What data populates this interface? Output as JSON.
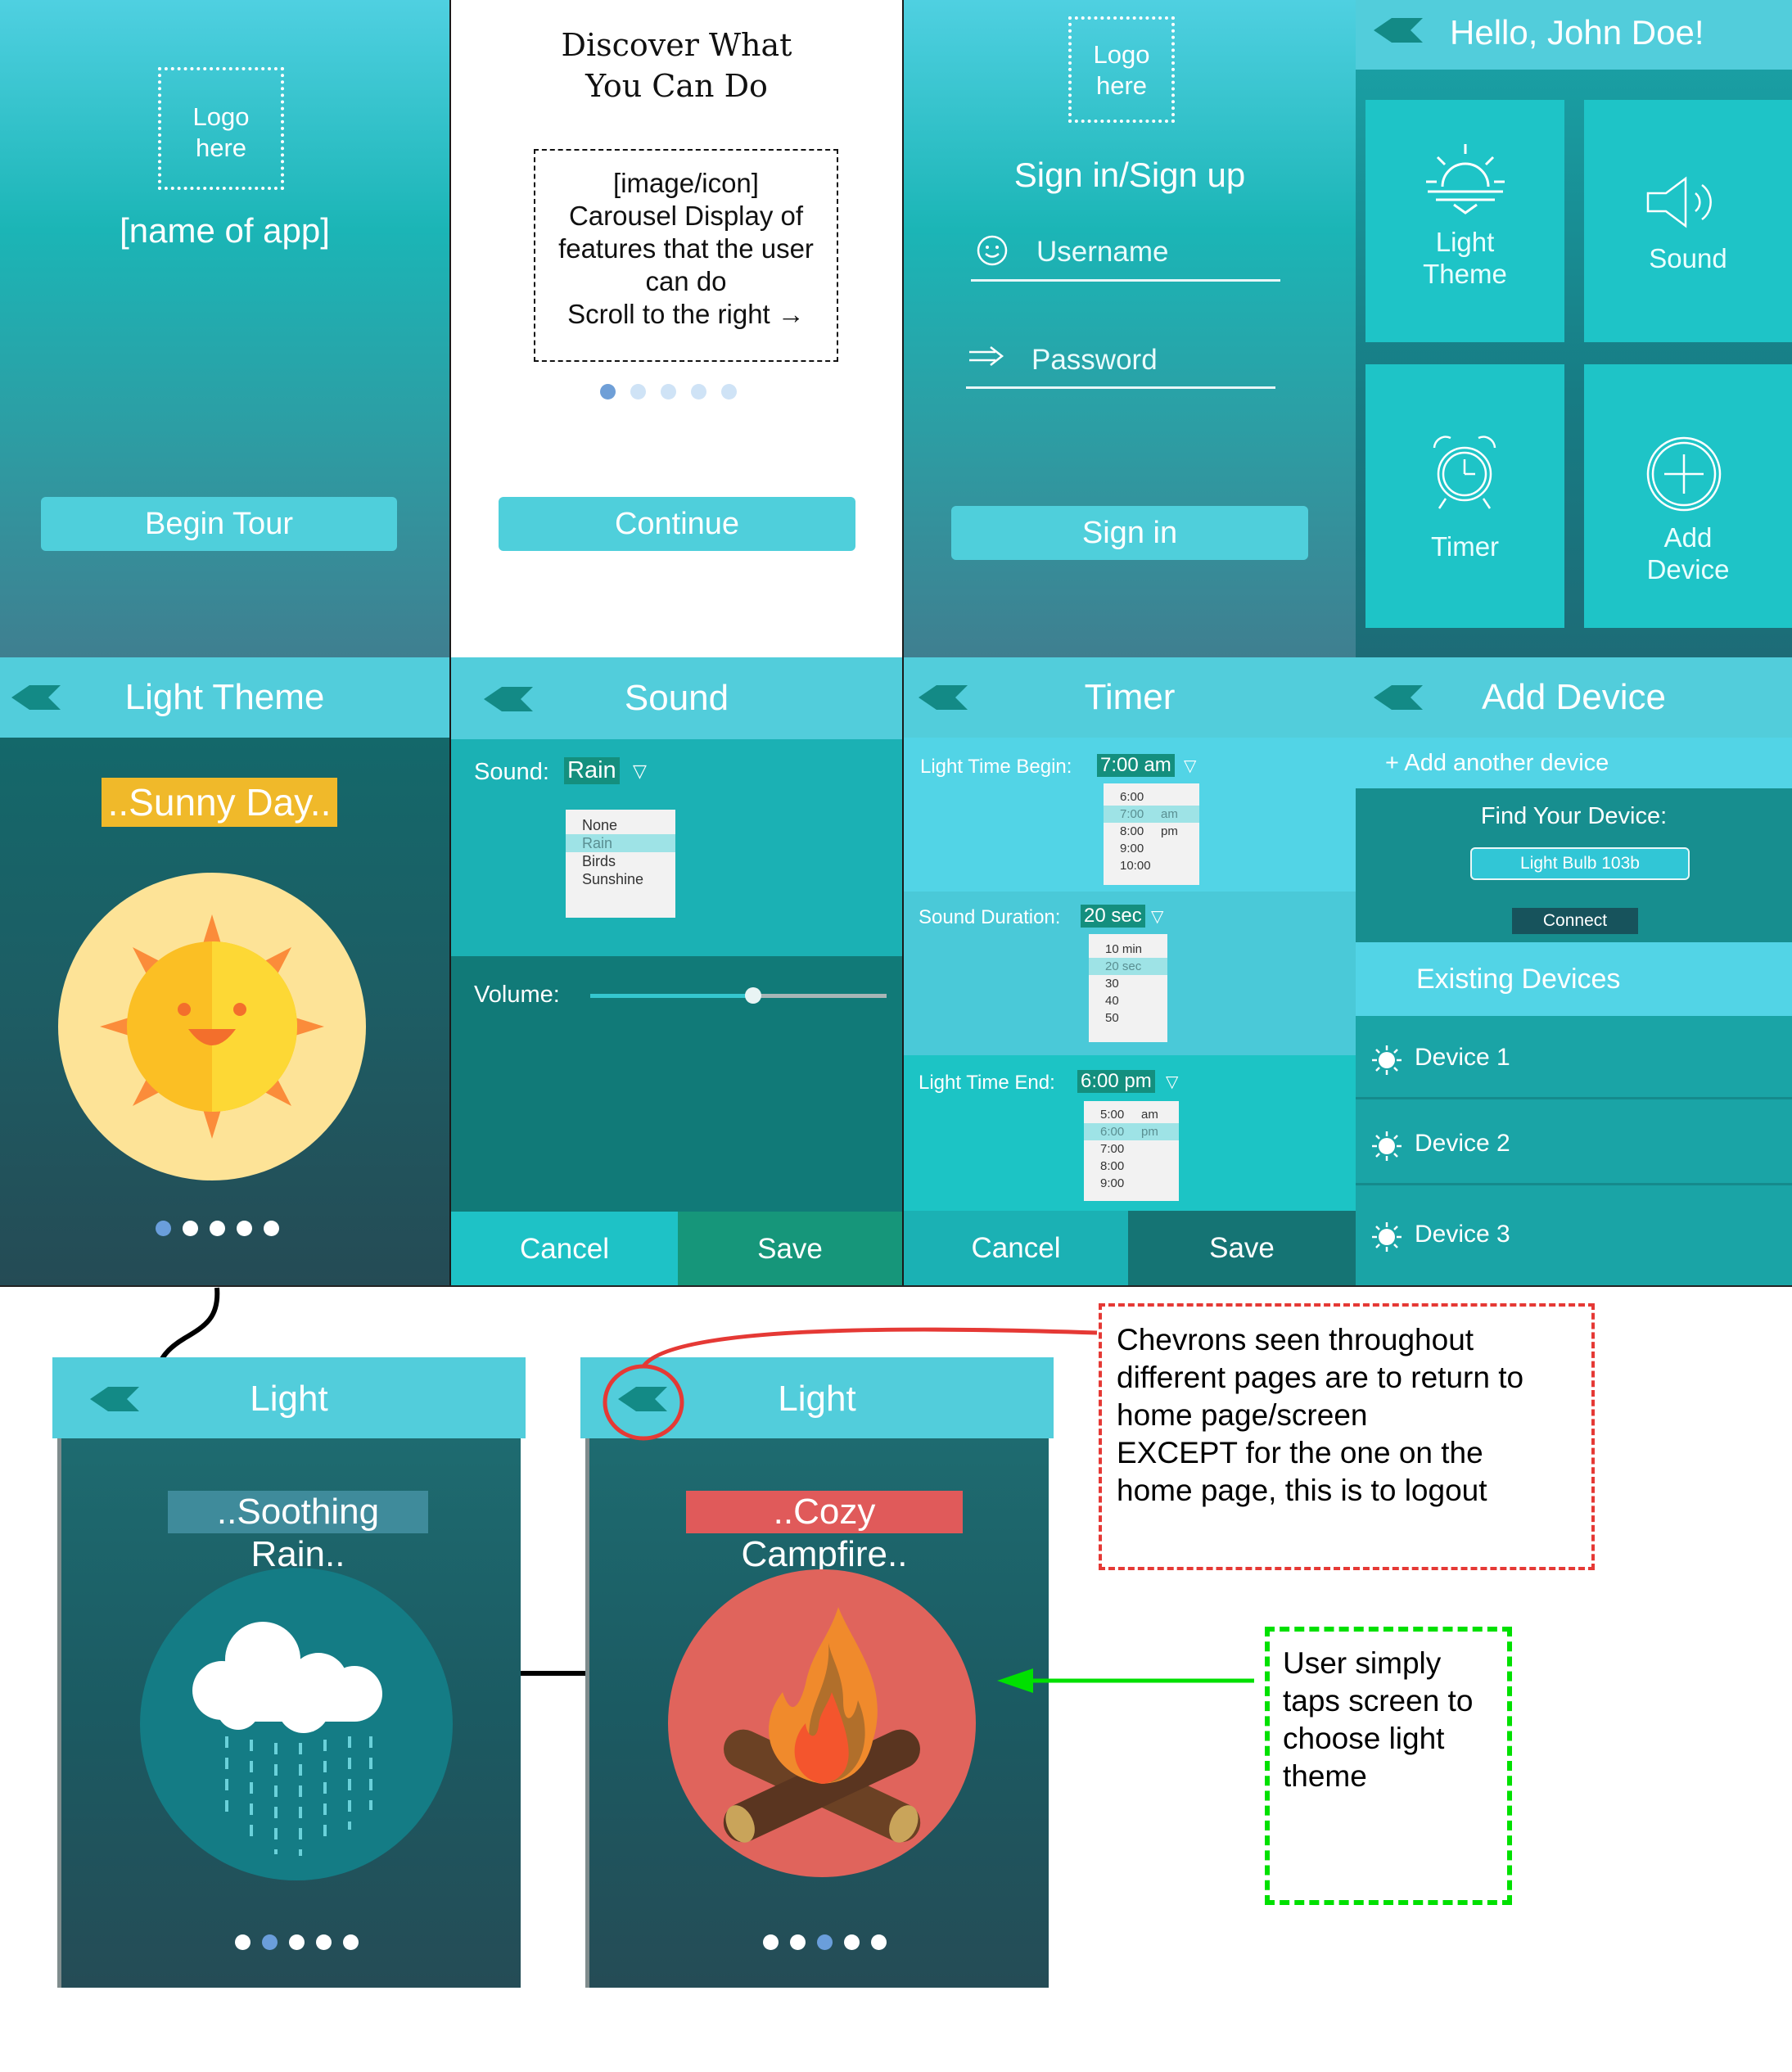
{
  "splash": {
    "logo_line1": "Logo",
    "logo_line2": "here",
    "app_name": "[name of app]",
    "begin_tour_label": "Begin Tour"
  },
  "discover": {
    "title_line1": "Discover What",
    "title_line2": "You Can Do",
    "carousel_lines": [
      "[image/icon]",
      "Carousel Display of",
      "features that the user",
      "can do",
      "Scroll to the right →"
    ],
    "continue_label": "Continue",
    "active_dot": 0
  },
  "signin": {
    "logo_line1": "Logo",
    "logo_line2": "here",
    "title": "Sign in/Sign up",
    "username_placeholder": "Username",
    "password_placeholder": "Password",
    "signin_label": "Sign in"
  },
  "home": {
    "greeting": "Hello, John Doe!",
    "tiles": [
      {
        "label_line1": "Light",
        "label_line2": "Theme",
        "icon": "sunrise-icon"
      },
      {
        "label_line1": "Sound",
        "label_line2": "",
        "icon": "speaker-icon"
      },
      {
        "label_line1": "Timer",
        "label_line2": "",
        "icon": "alarm-clock-icon"
      },
      {
        "label_line1": "Add",
        "label_line2": "Device",
        "icon": "plus-circle-icon"
      }
    ]
  },
  "light_theme": {
    "title": "Light Theme",
    "theme_name": "..Sunny Day..",
    "active_dot": 0
  },
  "sound": {
    "title": "Sound",
    "sound_label": "Sound:",
    "sound_value": "Rain",
    "options": [
      "None",
      "Rain",
      "Birds",
      "Sunshine"
    ],
    "selected_option": "Rain",
    "volume_label": "Volume:",
    "volume_level": 0.55,
    "cancel_label": "Cancel",
    "save_label": "Save"
  },
  "timer": {
    "title": "Timer",
    "begin_label": "Light Time Begin:",
    "begin_value": "7:00 am",
    "begin_options": [
      "6:00",
      "7:00     am",
      "8:00     pm",
      "9:00",
      "10:00"
    ],
    "duration_label": "Sound Duration:",
    "duration_value": "20 sec",
    "duration_options": [
      "10 min",
      "20 sec",
      "30",
      "40",
      "50"
    ],
    "end_label": "Light Time End:",
    "end_value": "6:00 pm",
    "end_options": [
      "5:00     am",
      "6:00     pm",
      "7:00",
      "8:00",
      "9:00"
    ],
    "cancel_label": "Cancel",
    "save_label": "Save"
  },
  "add_device": {
    "title": "Add Device",
    "add_another": "+ Add another device",
    "find_label": "Find Your Device:",
    "device_input_value": "Light Bulb 103b",
    "connect_label": "Connect",
    "existing_label": "Existing Devices",
    "devices": [
      "Device 1",
      "Device 2",
      "Device 3"
    ]
  },
  "rain": {
    "title": "Light",
    "theme_name": "..Soothing Rain..",
    "active_dot": 1
  },
  "campfire": {
    "title": "Light",
    "theme_name": "..Cozy Campfire..",
    "active_dot": 2
  },
  "annotations": {
    "chevron_note_lines": [
      "Chevrons seen throughout",
      "different pages are to return to",
      "home page/screen",
      "EXCEPT for the one on the",
      "home page, this is to logout"
    ],
    "tap_note_lines": [
      "User simply",
      "taps screen to",
      "choose light",
      "theme"
    ]
  },
  "colors": {
    "header": "#52cddb",
    "teal_dark": "#117576",
    "accent_red": "#e53935",
    "accent_green": "#00e000",
    "chevron": "#138a86"
  }
}
